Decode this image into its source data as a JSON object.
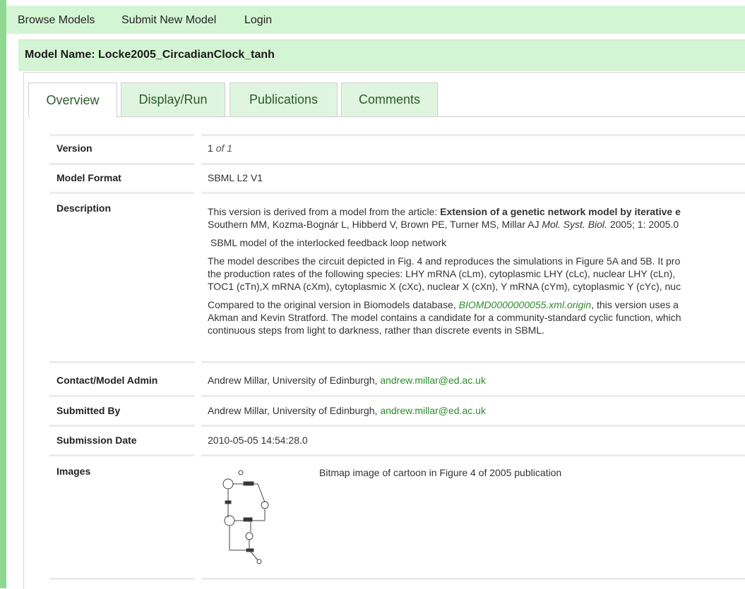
{
  "nav": {
    "browse": "Browse Models",
    "submit": "Submit New Model",
    "login": "Login"
  },
  "title": "Model Name: Locke2005_CircadianClock_tanh",
  "tabs": [
    "Overview",
    "Display/Run",
    "Publications",
    "Comments"
  ],
  "fields": {
    "version_label": "Version",
    "version_num": "1",
    "version_of": "of 1",
    "format_label": "Model Format",
    "format_value": "SBML L2 V1",
    "desc_label": "Description",
    "desc_line1_a": "This version is derived from a model from the article: ",
    "desc_line1_b": "Extension of a genetic network model by iterative e",
    "desc_line2_a": "Southern MM, Kozma-Bognár L, Hibberd V, Brown PE, Turner MS, Millar AJ ",
    "desc_line2_journal": "Mol. Syst. Biol.",
    "desc_line2_b": " 2005; 1: 2005.0",
    "desc_line3": "SBML model of the interlocked feedback loop network",
    "desc_line4": "The model describes the circuit depicted in Fig. 4 and reproduces the simulations in Figure 5A and 5B. It pro",
    "desc_line5": "the production rates of the following species: LHY mRNA (cLm), cytoplasmic LHY (cLc), nuclear LHY (cLn),",
    "desc_line6": "TOC1 (cTn),X mRNA (cXm), cytoplasmic X (cXc), nuclear X (cXn), Y mRNA (cYm), cytoplasmic Y (cYc), nuc",
    "desc_line7_a": "Compared to the original version in Biomodels database, ",
    "desc_line7_link": "BIOMD0000000055.xml.origin",
    "desc_line7_b": ", this version uses a",
    "desc_line8": "Akman and Kevin Stratford. The model contains a candidate for a community-standard cyclic function, which",
    "desc_line9": "continuous steps from light to darkness, rather than discrete events in SBML.",
    "contact_label": "Contact/Model Admin",
    "contact_text": "Andrew Millar, University of Edinburgh, ",
    "contact_email": "andrew.millar@ed.ac.uk",
    "submitted_label": "Submitted By",
    "submitted_text": "Andrew Millar, University of Edinburgh, ",
    "submitted_email": "andrew.millar@ed.ac.uk",
    "date_label": "Submission Date",
    "date_value": "2010-05-05 14:54:28.0",
    "images_label": "Images",
    "image_caption": "Bitmap image of cartoon in Figure 4 of 2005 publication"
  },
  "colors": {
    "nav_bg": "#d4f5d4",
    "stripe": "#8fd88f",
    "link": "#2c8c2c",
    "tab_bg": "#dff5df"
  }
}
